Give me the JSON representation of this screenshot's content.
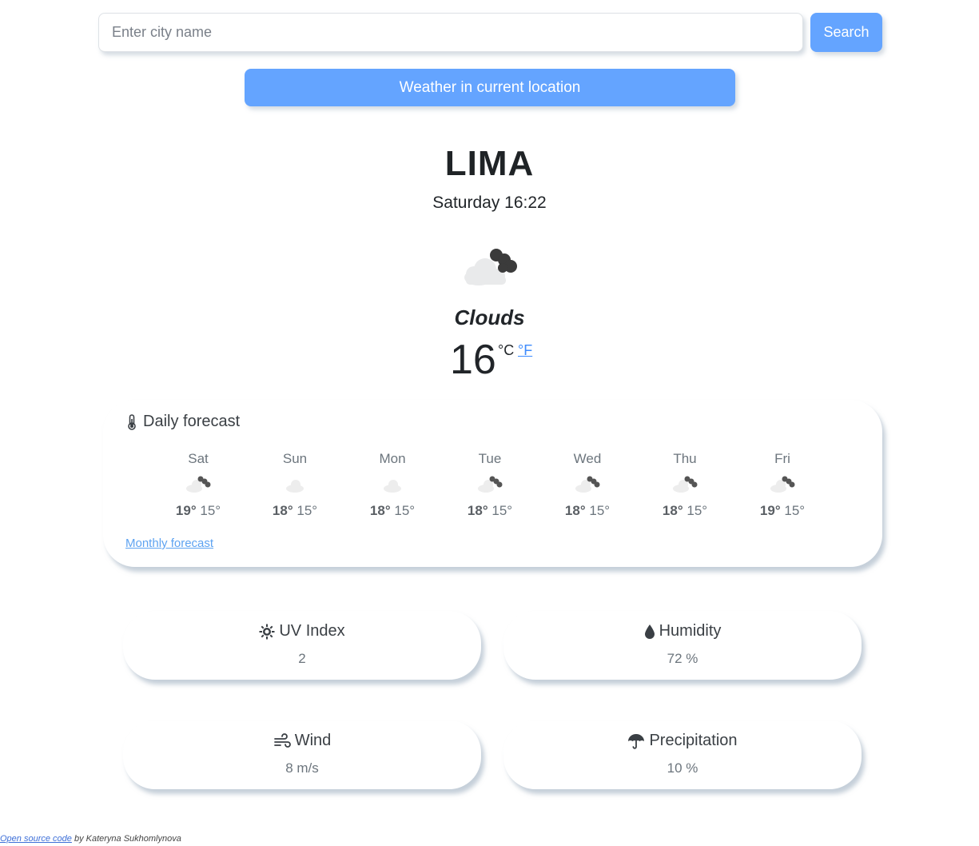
{
  "search": {
    "placeholder": "Enter city name",
    "value": "",
    "button_label": "Search"
  },
  "location_button_label": "Weather in current location",
  "current": {
    "city": "LIMA",
    "datetime": "Saturday 16:22",
    "icon": "broken-clouds-icon",
    "description": "Clouds",
    "temperature": "16",
    "unit_celsius": "°C",
    "unit_fahrenheit": "°F"
  },
  "daily_forecast": {
    "title": "Daily forecast",
    "icon": "thermometer-icon",
    "days": [
      {
        "day": "Sat",
        "icon": "broken-clouds-icon",
        "max": "19°",
        "min": "15°"
      },
      {
        "day": "Sun",
        "icon": "few-clouds-icon",
        "max": "18°",
        "min": "15°"
      },
      {
        "day": "Mon",
        "icon": "few-clouds-icon",
        "max": "18°",
        "min": "15°"
      },
      {
        "day": "Tue",
        "icon": "broken-clouds-icon",
        "max": "18°",
        "min": "15°"
      },
      {
        "day": "Wed",
        "icon": "broken-clouds-icon",
        "max": "18°",
        "min": "15°"
      },
      {
        "day": "Thu",
        "icon": "broken-clouds-icon",
        "max": "18°",
        "min": "15°"
      },
      {
        "day": "Fri",
        "icon": "broken-clouds-icon",
        "max": "19°",
        "min": "15°"
      }
    ],
    "monthly_link": "Monthly forecast"
  },
  "stats": {
    "uv": {
      "label": "UV Index",
      "value": "2",
      "icon": "sun-icon"
    },
    "humidity": {
      "label": "Humidity",
      "value": "72 %",
      "icon": "droplet-icon"
    },
    "wind": {
      "label": "Wind",
      "value": "8 m/s",
      "icon": "wind-icon"
    },
    "precipitation": {
      "label": "Precipitation",
      "value": "10 %",
      "icon": "umbrella-icon"
    }
  },
  "footer": {
    "link_text": "Open source code",
    "author_text": " by Kateryna Sukhomlynova"
  },
  "colors": {
    "accent": "#64a4ff",
    "link": "#3d8bfd",
    "muted_text": "#6c757d"
  }
}
